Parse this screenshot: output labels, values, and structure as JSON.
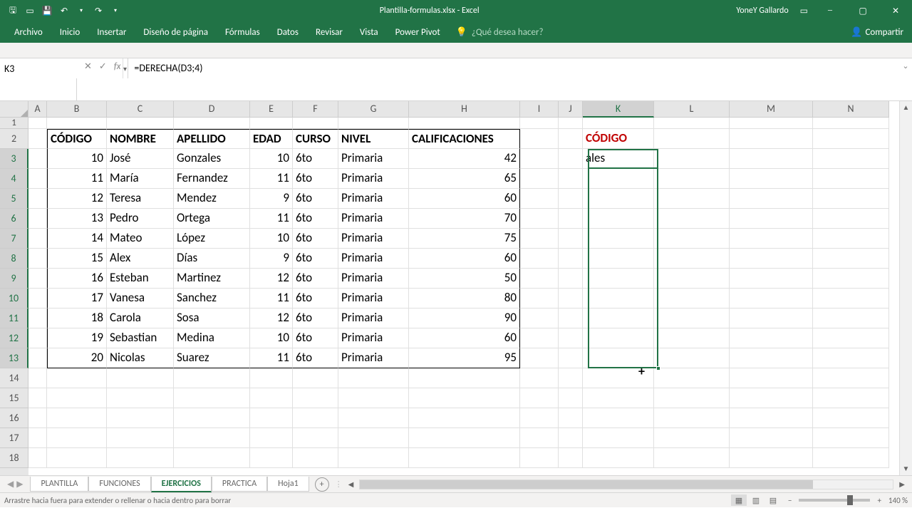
{
  "title": "Plantilla-formulas.xlsx  -  Excel",
  "user": "YoneY Gallardo",
  "ribbon_tabs": [
    "Archivo",
    "Inicio",
    "Insertar",
    "Diseño de página",
    "Fórmulas",
    "Datos",
    "Revisar",
    "Vista",
    "Power Pivot"
  ],
  "tellme": "¿Qué desea hacer?",
  "share": "Compartir",
  "name_box": "K3",
  "formula": "=DERECHA(D3;4)",
  "col_headers": [
    "A",
    "B",
    "C",
    "D",
    "E",
    "F",
    "G",
    "H",
    "I",
    "J",
    "K",
    "L",
    "M",
    "N"
  ],
  "row_headers": [
    1,
    2,
    3,
    4,
    5,
    6,
    7,
    8,
    9,
    10,
    11,
    12,
    13,
    14,
    15,
    16,
    17,
    18
  ],
  "table_header": [
    "CÓDIGO",
    "NOMBRE",
    "APELLIDO",
    "EDAD",
    "CURSO",
    "NIVEL",
    "CALIFICACIONES"
  ],
  "table_rows": [
    {
      "codigo": 10,
      "nombre": "José",
      "apellido": "Gonzales",
      "edad": 10,
      "curso": "6to",
      "nivel": "Primaria",
      "calif": 42
    },
    {
      "codigo": 11,
      "nombre": "María",
      "apellido": "Fernandez",
      "edad": 11,
      "curso": "6to",
      "nivel": "Primaria",
      "calif": 65
    },
    {
      "codigo": 12,
      "nombre": "Teresa",
      "apellido": "Mendez",
      "edad": 9,
      "curso": "6to",
      "nivel": "Primaria",
      "calif": 60
    },
    {
      "codigo": 13,
      "nombre": "Pedro",
      "apellido": "Ortega",
      "edad": 11,
      "curso": "6to",
      "nivel": "Primaria",
      "calif": 70
    },
    {
      "codigo": 14,
      "nombre": "Mateo",
      "apellido": "López",
      "edad": 10,
      "curso": "6to",
      "nivel": "Primaria",
      "calif": 75
    },
    {
      "codigo": 15,
      "nombre": "Alex",
      "apellido": "Días",
      "edad": 9,
      "curso": "6to",
      "nivel": "Primaria",
      "calif": 60
    },
    {
      "codigo": 16,
      "nombre": "Esteban",
      "apellido": "Martinez",
      "edad": 12,
      "curso": "6to",
      "nivel": "Primaria",
      "calif": 50
    },
    {
      "codigo": 17,
      "nombre": "Vanesa",
      "apellido": "Sanchez",
      "edad": 11,
      "curso": "6to",
      "nivel": "Primaria",
      "calif": 80
    },
    {
      "codigo": 18,
      "nombre": "Carola",
      "apellido": "Sosa",
      "edad": 12,
      "curso": "6to",
      "nivel": "Primaria",
      "calif": 90
    },
    {
      "codigo": 19,
      "nombre": "Sebastian",
      "apellido": "Medina",
      "edad": 10,
      "curso": "6to",
      "nivel": "Primaria",
      "calif": 60
    },
    {
      "codigo": 20,
      "nombre": "Nicolas",
      "apellido": "Suarez",
      "edad": 11,
      "curso": "6to",
      "nivel": "Primaria",
      "calif": 95
    }
  ],
  "k_header": "CÓDIGO",
  "k3_value": "ales",
  "sheet_tabs": [
    "PLANTILLA",
    "FUNCIONES",
    "EJERCICIOS",
    "PRACTICA",
    "Hoja1"
  ],
  "active_sheet": "EJERCICIOS",
  "status_msg": "Arrastre hacia fuera para extender o rellenar o hacia dentro para borrar",
  "zoom_pct": "140 %"
}
